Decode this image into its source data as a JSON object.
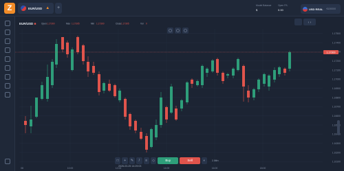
{
  "header": {
    "logo": "Z",
    "asset": "EUR/USD",
    "add": "+",
    "balance_label": "Model Balance",
    "balance_value": "$",
    "open_pnl_label": "Open P/L",
    "open_pnl_value": "0.00",
    "account_name": "USD REAL",
    "account_value": "€100000"
  },
  "chart": {
    "symbol": "EUR/USD",
    "ohlc": [
      {
        "label": "Open",
        "value": "1.17300"
      },
      {
        "label": "Max",
        "value": "1.17305"
      },
      {
        "label": "Min",
        "value": "1.17300"
      },
      {
        "label": "Close",
        "value": "1.17305"
      },
      {
        "label": "Vol",
        "value": "0"
      }
    ],
    "last_price": "1.17300",
    "price_ticks": [
      "1.17500",
      "1.17400",
      "1.17300",
      "1.17200",
      "1.17100",
      "1.17000",
      "1.16900",
      "1.16800",
      "1.16700",
      "1.16600",
      "1.16500",
      "1.16400",
      "1.16300",
      "1.16200",
      "1.16100"
    ],
    "time_ticks": [
      "08",
      "10:00",
      "12:00",
      "14:00",
      "16:00",
      "18:00"
    ],
    "colors": {
      "up": "#2e9e7a",
      "down": "#e0544c",
      "bg": "#1c2433",
      "grid": "#273144"
    }
  },
  "toolbar": {
    "time_display": "2026-03-25 14:29:03",
    "buy": "Buy",
    "sell": "Sell",
    "timeframe": "1 Min"
  }
}
